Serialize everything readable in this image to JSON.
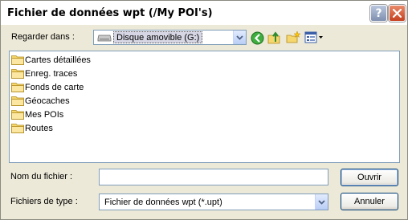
{
  "window": {
    "title": "Fichier de données wpt (/My POI's)",
    "help_glyph": "?",
    "close_glyph": "×"
  },
  "look_in": {
    "label": "Regarder dans :",
    "value": "Disque amovible (G:)",
    "drive_icon": "removable-drive-icon"
  },
  "toolbar": {
    "icons": [
      "back-arrow-icon",
      "up-folder-icon",
      "new-folder-icon",
      "views-menu-icon"
    ]
  },
  "files": [
    {
      "name": "Cartes détaillées",
      "icon": "folder-icon"
    },
    {
      "name": "Enreg. traces",
      "icon": "folder-icon"
    },
    {
      "name": "Fonds de carte",
      "icon": "folder-icon"
    },
    {
      "name": "Géocaches",
      "icon": "folder-icon"
    },
    {
      "name": "Mes POIs",
      "icon": "folder-icon"
    },
    {
      "name": "Routes",
      "icon": "folder-icon"
    }
  ],
  "file_name": {
    "label": "Nom du fichier :",
    "value": ""
  },
  "file_type": {
    "label": "Fichiers de type :",
    "value": "Fichier de données wpt (*.upt)"
  },
  "buttons": {
    "open": "Ouvrir",
    "cancel": "Annuler"
  },
  "colors": {
    "dialog_bg": "#ece9d8",
    "field_border": "#7f9db9",
    "folder_yellow": "#f5d76e",
    "close_red": "#c6401f"
  }
}
